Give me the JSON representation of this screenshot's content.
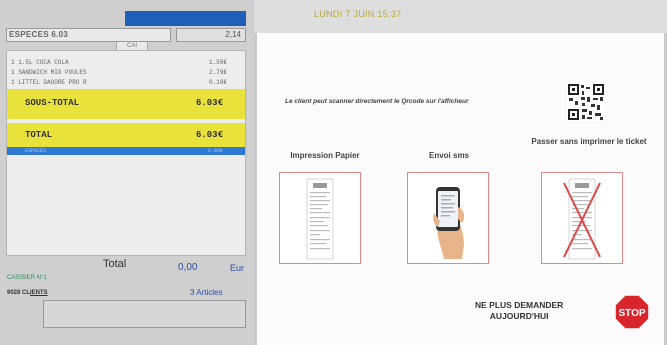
{
  "left": {
    "payment": {
      "label": "ESPECES  6.03",
      "amount": "2,14"
    },
    "tab_label": "CAI",
    "ticket_lines": [
      {
        "name": "1 1.5L COCA COLA",
        "price": "1.59€"
      },
      {
        "name": "1 SANDWICH MIX POULES",
        "price": "2.79€"
      },
      {
        "name": "1 LITTEL DAGORE PRO R",
        "price": "0.18€"
      }
    ],
    "subtotal": {
      "label": "SOUS-TOTAL",
      "value": "6.03€"
    },
    "total_line": {
      "label": "TOTAL",
      "value": "6.03€"
    },
    "selected_line": {
      "name": "ESPECES",
      "price": "6.03€"
    },
    "total_label": "Total",
    "total_value": "0,00",
    "total_currency": "Eur",
    "cashier": "CAISSIER N°1",
    "clients_prefix": "9028 CL",
    "clients_suffix": "IENTS",
    "articles": "3 Articles"
  },
  "header": {
    "date": "LUNDI 7 JUIN 15:37"
  },
  "modal": {
    "scan_text": "Le client peut scanner directement le Qrcode sur l'afficheur",
    "options": [
      {
        "label": "Impression Papier"
      },
      {
        "label": "Envoi sms"
      },
      {
        "label": "Passer sans imprimer le ticket"
      }
    ],
    "stop_label_line1": "NE PLUS DEMANDER",
    "stop_label_line2": "AUJOURD'HUI",
    "stop_icon_text": "STOP"
  },
  "colors": {
    "accent_blue": "#1f5fb8",
    "highlight_yellow": "#e8e23a",
    "stop_red": "#d9262c",
    "date_gold": "#b8a93a"
  }
}
